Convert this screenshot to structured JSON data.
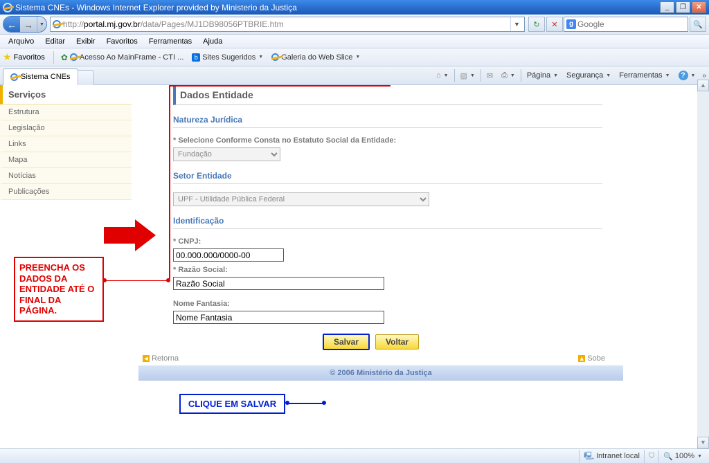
{
  "titlebar": {
    "text": "Sistema CNEs - Windows Internet Explorer provided by Ministerio da Justiça"
  },
  "navbar": {
    "url_prefix": "http://",
    "url_host": "portal.mj.gov.br",
    "url_path": "/data/Pages/MJ1DB98056PTBRIE.htm",
    "search_provider": "Google",
    "search_placeholder": "Google"
  },
  "menubar": {
    "items": [
      "Arquivo",
      "Editar",
      "Exibir",
      "Favoritos",
      "Ferramentas",
      "Ajuda"
    ]
  },
  "favbar": {
    "label": "Favoritos",
    "items": [
      "Acesso Ao MainFrame - CTI ...",
      "Sites Sugeridos",
      "Galeria do Web Slice"
    ]
  },
  "cmdbar": {
    "tab_title": "Sistema CNEs",
    "items": [
      "Página",
      "Segurança",
      "Ferramentas"
    ]
  },
  "sidebar": {
    "header": "Serviços",
    "items": [
      "Estrutura",
      "Legislação",
      "Links",
      "Mapa",
      "Notícias",
      "Publicações"
    ]
  },
  "form": {
    "title": "Dados Entidade",
    "sec_natureza": "Natureza Jurídica",
    "lbl_selecione": "* Selecione Conforme Consta no Estatuto Social da Entidade:",
    "val_fundacao": "Fundação",
    "sec_setor": "Setor Entidade",
    "val_upf": "UPF - Utilidade Pública Federal",
    "sec_ident": "Identificação",
    "lbl_cnpj": "* CNPJ:",
    "val_cnpj": "00.000.000/0000-00",
    "lbl_razao": "* Razão Social:",
    "val_razao": "Razão Social",
    "lbl_fantasia": "Nome Fantasia:",
    "val_fantasia": "Nome Fantasia",
    "btn_salvar": "Salvar",
    "btn_voltar": "Voltar",
    "link_retorna": "Retorna",
    "link_sobe": "Sobe",
    "copyright": "© 2006 Ministério da Justiça"
  },
  "annotations": {
    "red_box": "PREENCHA OS DADOS DA ENTIDADE ATÉ O FINAL DA PÁGINA.",
    "blue_box": "CLIQUE EM SALVAR"
  },
  "statusbar": {
    "zone": "Intranet local",
    "zoom": "100%"
  }
}
